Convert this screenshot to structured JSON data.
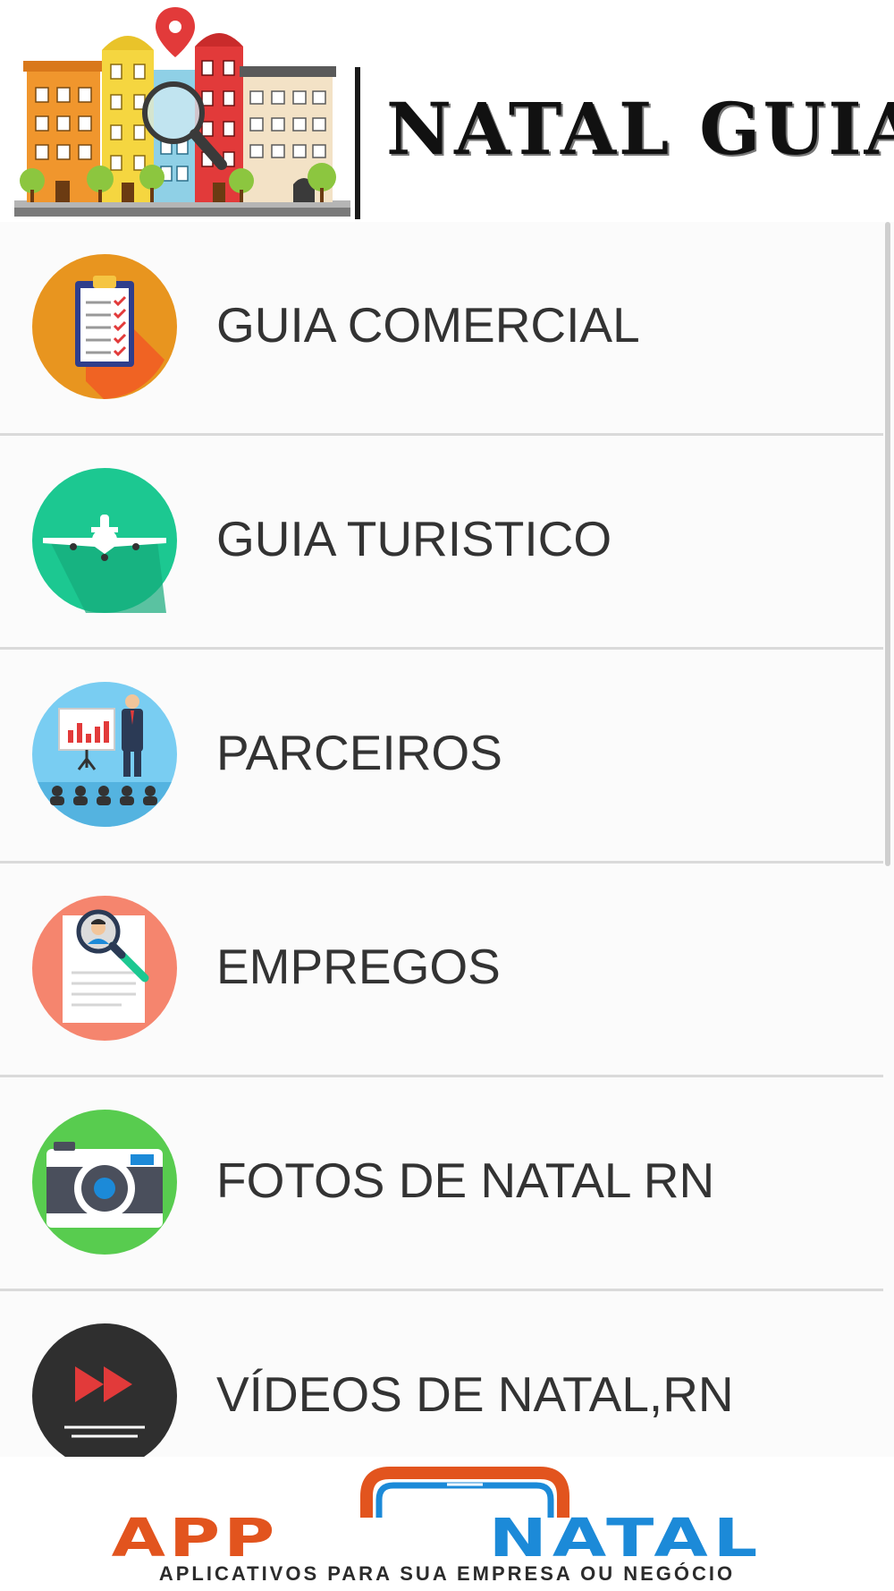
{
  "header": {
    "title": "NATAL GUIA"
  },
  "menu": {
    "items": [
      {
        "label": "GUIA COMERCIAL",
        "icon": "clipboard-checklist-icon",
        "color": "#e8951f"
      },
      {
        "label": "GUIA TURISTICO",
        "icon": "airplane-icon",
        "color": "#1cc891"
      },
      {
        "label": "PARCEIROS",
        "icon": "presentation-icon",
        "color": "#79cdf2"
      },
      {
        "label": "EMPREGOS",
        "icon": "resume-search-icon",
        "color": "#f5856e"
      },
      {
        "label": "FOTOS DE NATAL RN",
        "icon": "camera-icon",
        "color": "#58cc4f"
      },
      {
        "label": "VÍDEOS DE NATAL,RN",
        "icon": "video-play-icon",
        "color": "#2f2f2f"
      }
    ]
  },
  "footer": {
    "brand_app": "APP",
    "brand_natal": "NATAL",
    "tagline": "APLICATIVOS PARA SUA EMPRESA OU NEGÓCIO",
    "colors": {
      "app": "#e2541e",
      "natal": "#1c8ad8"
    }
  }
}
